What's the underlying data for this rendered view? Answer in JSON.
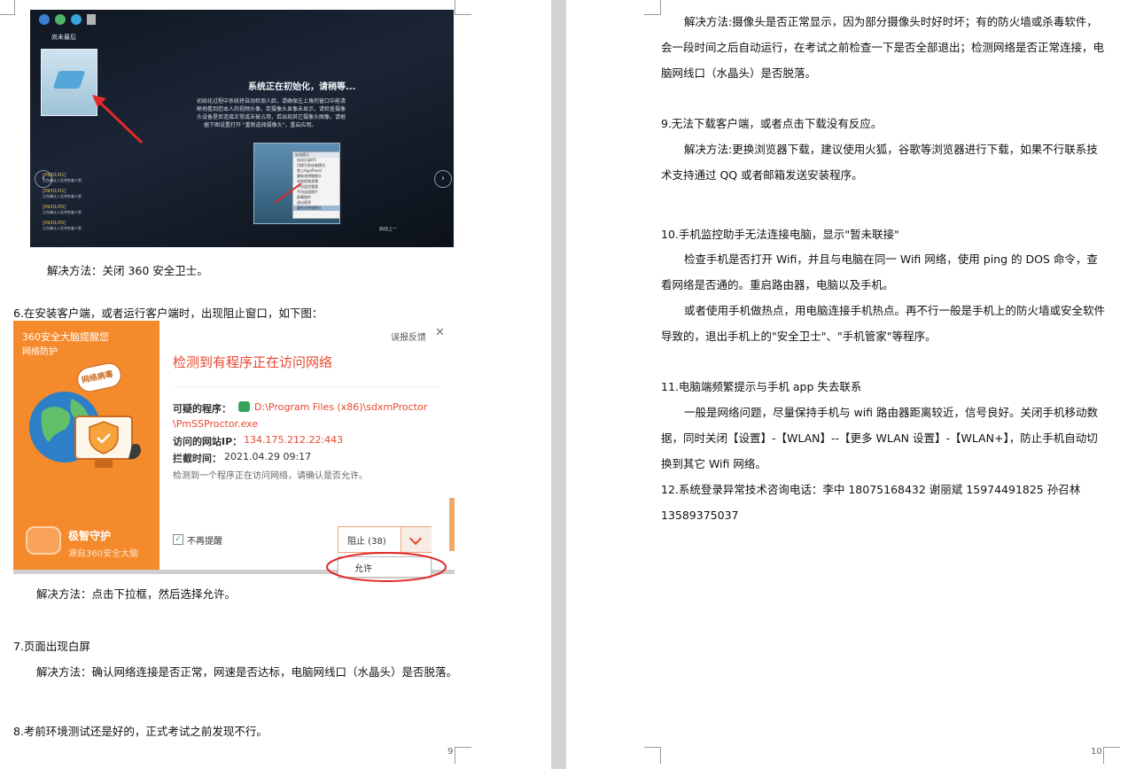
{
  "left_page": {
    "photo": {
      "desktop_icon_label": "尚未最后",
      "title": "系统正在初始化，请稍等...",
      "body_lines": [
        "初始化过程中系统将自动检测人脸，请确保左上角的窗口中能清",
        "晰地看到您本人的视频头像，若摄像头显像未显示，请检查摄像",
        "头设备是否连接正常或未被占用，若出现其它摄像头图像，请根",
        "据下图设置打开 \"重新选择摄像头\"，重启应用。"
      ],
      "menu_items": [
        "启动记录(R)",
        "切换为多成者模式",
        "禁止App/Panel",
        "重新选择摄像头",
        "本地视频清零",
        "手机监控管理",
        "手机连接照片",
        "屏幕操作",
        "退出程序",
        "重新选择摄像头"
      ],
      "menu_header": "启动提示",
      "notif_items": [
        "[09/01/01]",
        "[09/01/01]",
        "[09/01/05]",
        "[09/01/05]"
      ],
      "notif_text": "正在确认人员并检查人脸",
      "bottom_label": "启动上一"
    },
    "solution1": "解决方法：关闭 360 安全卫士。",
    "item6": "6.在安装客户端，或者运行客户端时，出现阻止窗口，如下图：",
    "dialog": {
      "brand": "360安全大脑提醒您",
      "subtitle": "网络防护",
      "report": "误报反馈",
      "close": "✕",
      "bubble": "网络病毒",
      "headline": "检测到有程序正在访问网络",
      "program_label": "可疑的程序：",
      "program_path_1": "D:\\Program Files (x86)\\sdxmProctor",
      "program_path_2": "\\PmSSProctor.exe",
      "site_label": "访问的网站IP：",
      "site_ip": "134.175.212.22:443",
      "time_label": "拦截时间：",
      "time_value": "2021.04.29 09:17",
      "note": "检测到一个程序正在访问网络，请确认是否允许。",
      "guard_title": "极智守护",
      "guard_sub": "源自360安全大脑",
      "checkbox_label": "不再提醒",
      "block_button": "阻止 (38)",
      "allow_option": "允许"
    },
    "solution2": "解决方法：点击下拉框，然后选择允许。",
    "item7": "7.页面出现白屏",
    "solution3": "解决方法：确认网络连接是否正常，网速是否达标，电脑网线口（水晶头）是否脱落。",
    "item8": "8.考前环境测试还是好的，正式考试之前发现不行。",
    "page_number": "9"
  },
  "right_page": {
    "para1": "解决方法:摄像头是否正常显示，因为部分摄像头时好时坏；有的防火墙或杀毒软件，会一段时间之后自动运行，在考试之前检查一下是否全部退出；检测网络是否正常连接，电脑网线口（水晶头）是否脱落。",
    "item9": "9.无法下载客户端，或者点击下载没有反应。",
    "para2": "解决方法:更换浏览器下载，建议使用火狐，谷歌等浏览器进行下载，如果不行联系技术支持通过 QQ 或者邮箱发送安装程序。",
    "item10": "10.手机监控助手无法连接电脑，显示\"暂未联接\"",
    "para3": "检查手机是否打开 Wifi，并且与电脑在同一 Wifi 网络，使用 ping 的 DOS 命令，查看网络是否通的。重启路由器，电脑以及手机。",
    "para4": "或者使用手机做热点，用电脑连接手机热点。再不行一般是手机上的防火墙或安全软件导致的，退出手机上的\"安全卫士\"、\"手机管家\"等程序。",
    "item11": "11.电脑端频繁提示与手机 app 失去联系",
    "para5": "一般是网络问题，尽量保持手机与 wifi 路由器距离较近，信号良好。关闭手机移动数据，同时关闭【设置】-【WLAN】--【更多 WLAN 设置】-【WLAN+】，防止手机自动切换到其它 Wifi 网络。",
    "item12": "12.系统登录异常技术咨询电话：李中 18075168432 谢丽斌 15974491825 孙召林 13589375037",
    "page_number": "10"
  },
  "colors": {
    "orange": "#f58a2d",
    "red_text": "#e8472e",
    "annotation_red": "#e02a2a"
  }
}
